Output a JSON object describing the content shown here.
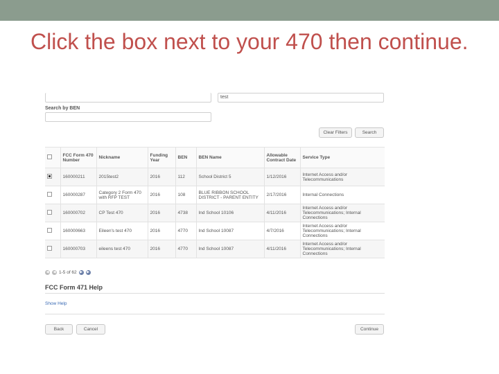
{
  "slide": {
    "title": "Click the box next to your 470 then continue."
  },
  "search": {
    "top_value": "test",
    "ben_label": "Search by BEN",
    "ben_value": ""
  },
  "buttons": {
    "clear_filters": "Clear Filters",
    "search": "Search",
    "back": "Back",
    "cancel": "Cancel",
    "continue": "Continue"
  },
  "table": {
    "headers": [
      "FCC Form 470 Number",
      "Nickname",
      "Funding Year",
      "BEN",
      "BEN Name",
      "Allowable Contract Date",
      "Service Type"
    ],
    "rows": [
      {
        "checked": true,
        "cells": [
          "160000211",
          "2015test2",
          "2016",
          "112",
          "School District 5",
          "1/12/2016",
          "Internet Access and/or Telecommunications"
        ]
      },
      {
        "checked": false,
        "cells": [
          "160000287",
          "Category 2 Form 470 with RFP TEST",
          "2016",
          "108",
          "BLUE RIBBON SCHOOL DISTRICT - PARENT ENTITY",
          "2/17/2016",
          "Internal Connections"
        ]
      },
      {
        "checked": false,
        "cells": [
          "160000702",
          "CP Test 470",
          "2016",
          "4738",
          "Ind School 10106",
          "4/11/2016",
          "Internet Access and/or Telecommunications; Internal Connections"
        ]
      },
      {
        "checked": false,
        "cells": [
          "160000663",
          "Eileen's test 470",
          "2016",
          "4770",
          "Ind School 10087",
          "4/7/2016",
          "Internet Access and/or Telecommunications; Internal Connections"
        ]
      },
      {
        "checked": false,
        "cells": [
          "160000703",
          "eileens test 470",
          "2016",
          "4770",
          "Ind School 10087",
          "4/11/2016",
          "Internet Access and/or Telecommunications; Internal Connections"
        ]
      }
    ]
  },
  "pager": {
    "text": "1-5 of 62"
  },
  "help": {
    "title": "FCC Form 471 Help",
    "show_help": "Show Help"
  },
  "icons": {
    "first": "first-page-icon",
    "prev": "prev-page-icon",
    "next": "next-page-icon",
    "last": "last-page-icon"
  }
}
